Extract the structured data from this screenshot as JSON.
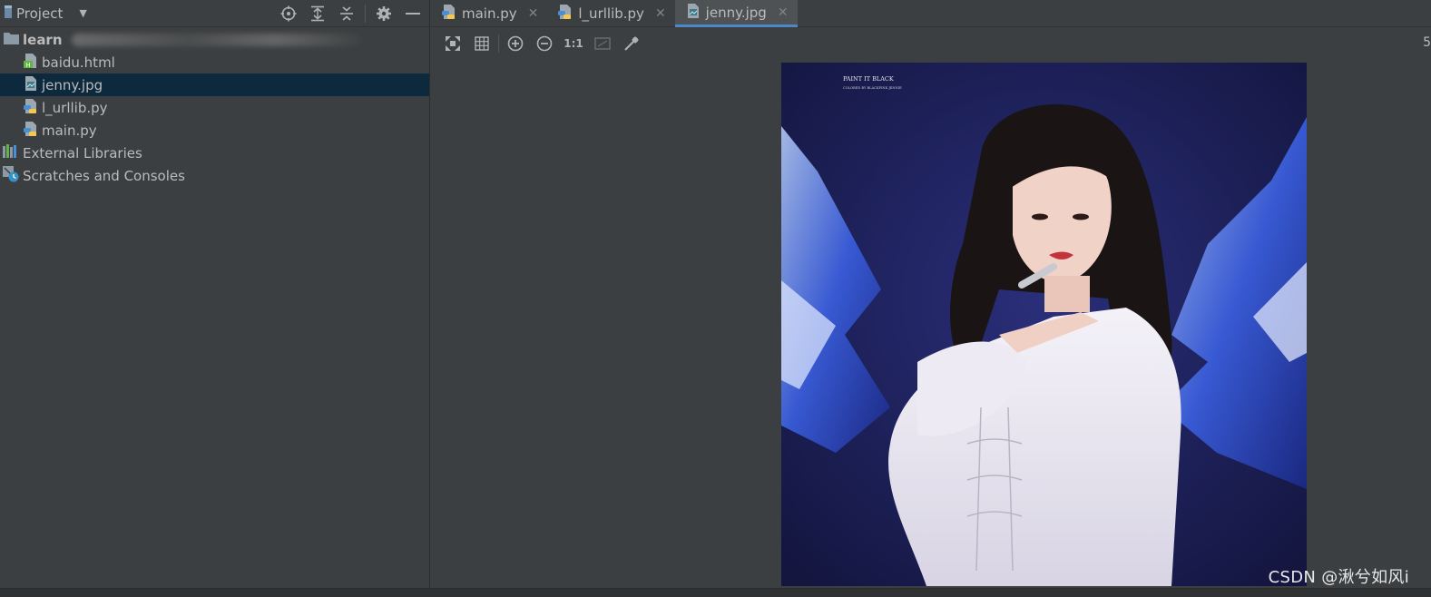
{
  "project_panel": {
    "title": "Project",
    "tree": [
      {
        "label": "learn",
        "type": "root-folder"
      },
      {
        "label": "baidu.html",
        "type": "html-file"
      },
      {
        "label": "jenny.jpg",
        "type": "image-file",
        "selected": true
      },
      {
        "label": "l_urllib.py",
        "type": "python-file"
      },
      {
        "label": "main.py",
        "type": "python-file"
      },
      {
        "label": "External Libraries",
        "type": "libraries"
      },
      {
        "label": "Scratches and Consoles",
        "type": "scratches"
      }
    ]
  },
  "editor": {
    "tabs": [
      {
        "label": "main.py",
        "icon": "python-file-icon",
        "active": false
      },
      {
        "label": "l_urllib.py",
        "icon": "python-file-icon",
        "active": false
      },
      {
        "label": "jenny.jpg",
        "icon": "image-file-icon",
        "active": true
      }
    ],
    "image_toolbar": {
      "actual_size_label": "1:1",
      "zoom_readout": "5"
    },
    "image": {
      "caption_line1": "PAINT IT BLACK",
      "caption_line2": "COLORED BY BLACKPINK JENNIE"
    }
  },
  "watermark": "CSDN @湫兮如风i",
  "colors": {
    "panel_bg": "#3c3f41",
    "selection": "#0d293e",
    "active_tab_underline": "#4a88c7",
    "text": "#bbbbbb"
  }
}
